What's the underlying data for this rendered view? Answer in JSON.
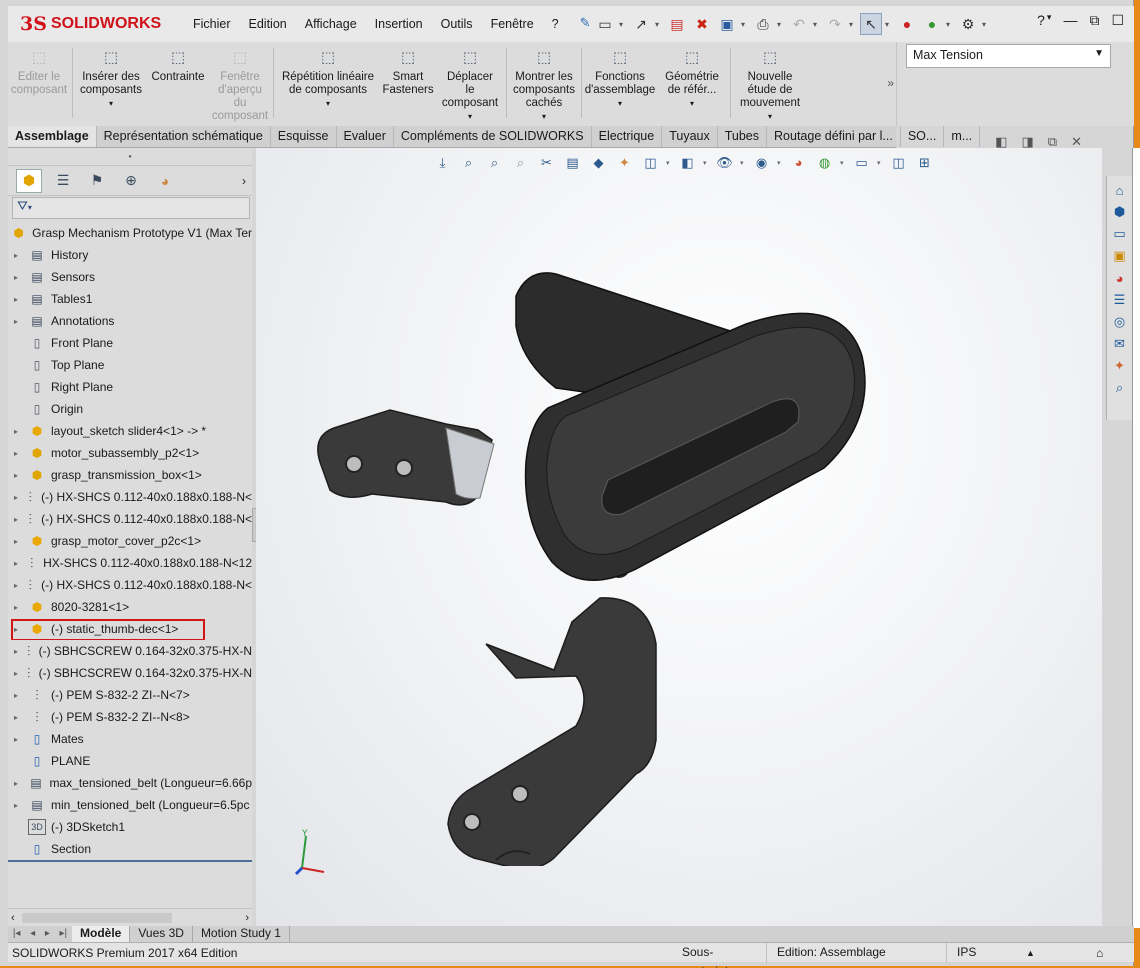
{
  "app": {
    "logo_ds": "3S",
    "logo_text": "SOLIDWORKS"
  },
  "menu": [
    "Fichier",
    "Edition",
    "Affichage",
    "Insertion",
    "Outils",
    "Fenêtre",
    "?"
  ],
  "config_combo": {
    "value": "Max Tension"
  },
  "commands": [
    {
      "label": "Editer le composant",
      "icon": "edit-component-icon",
      "disabled": true
    },
    {
      "label": "Insérer des composants",
      "icon": "insert-components-icon",
      "disabled": false
    },
    {
      "label": "Contrainte",
      "icon": "mate-icon",
      "disabled": false
    },
    {
      "label": "Fenêtre d'aperçu du composant",
      "icon": "preview-window-icon",
      "disabled": true
    },
    {
      "label": "Répétition linéaire de composants",
      "icon": "linear-pattern-icon",
      "disabled": false
    },
    {
      "label": "Smart Fasteners",
      "icon": "smart-fasteners-icon",
      "disabled": false
    },
    {
      "label": "Déplacer le composant",
      "icon": "move-component-icon",
      "disabled": false
    },
    {
      "label": "Montrer les composants cachés",
      "icon": "show-hidden-icon",
      "disabled": false
    },
    {
      "label": "Fonctions d'assemblage",
      "icon": "assembly-features-icon",
      "disabled": false
    },
    {
      "label": "Géométrie de référ...",
      "icon": "reference-geometry-icon",
      "disabled": false
    },
    {
      "label": "Nouvelle étude de mouvement",
      "icon": "motion-study-icon",
      "disabled": false
    }
  ],
  "tabs": [
    "Assemblage",
    "Représentation schématique",
    "Esquisse",
    "Evaluer",
    "Compléments de SOLIDWORKS",
    "Electrique",
    "Tuyaux",
    "Tubes",
    "Routage défini par l...",
    "SO...",
    "m..."
  ],
  "tree": {
    "root": "Grasp Mechanism Prototype V1  (Max Ter",
    "items": [
      {
        "label": "History",
        "icon": "history-icon",
        "kind": "folder",
        "expand": true
      },
      {
        "label": "Sensors",
        "icon": "sensors-icon",
        "kind": "folder",
        "expand": true
      },
      {
        "label": "Tables1",
        "icon": "tables-icon",
        "kind": "folder",
        "expand": true
      },
      {
        "label": "Annotations",
        "icon": "annotations-icon",
        "kind": "folder",
        "expand": true
      },
      {
        "label": "Front Plane",
        "icon": "plane-icon",
        "kind": "plane",
        "expand": false
      },
      {
        "label": "Top Plane",
        "icon": "plane-icon",
        "kind": "plane",
        "expand": false
      },
      {
        "label": "Right Plane",
        "icon": "plane-icon",
        "kind": "plane",
        "expand": false
      },
      {
        "label": "Origin",
        "icon": "origin-icon",
        "kind": "plane",
        "expand": false
      },
      {
        "label": "layout_sketch slider4<1> -> *",
        "icon": "part-icon",
        "kind": "part",
        "expand": true
      },
      {
        "label": "motor_subassembly_p2<1>",
        "icon": "assembly-icon",
        "kind": "asm",
        "expand": true
      },
      {
        "label": "grasp_transmission_box<1>",
        "icon": "assembly-icon",
        "kind": "asm",
        "expand": true
      },
      {
        "label": "(-) HX-SHCS 0.112-40x0.188x0.188-N<",
        "icon": "screw-icon",
        "kind": "screw",
        "expand": true
      },
      {
        "label": "(-) HX-SHCS 0.112-40x0.188x0.188-N<",
        "icon": "screw-icon",
        "kind": "screw",
        "expand": true
      },
      {
        "label": "grasp_motor_cover_p2c<1>",
        "icon": "part-icon",
        "kind": "part",
        "expand": true
      },
      {
        "label": "HX-SHCS 0.112-40x0.188x0.188-N<12",
        "icon": "screw-icon",
        "kind": "screw",
        "expand": true
      },
      {
        "label": "(-) HX-SHCS 0.112-40x0.188x0.188-N<",
        "icon": "screw-icon",
        "kind": "screw",
        "expand": true
      },
      {
        "label": "8020-3281<1>",
        "icon": "part-icon",
        "kind": "part",
        "expand": true
      },
      {
        "label": "(-) static_thumb-dec<1>",
        "icon": "part-icon",
        "kind": "part",
        "expand": true,
        "highlight": true
      },
      {
        "label": "(-) SBHCSCREW 0.164-32x0.375-HX-N",
        "icon": "screw-icon",
        "kind": "screw",
        "expand": true
      },
      {
        "label": "(-) SBHCSCREW 0.164-32x0.375-HX-N",
        "icon": "screw-icon",
        "kind": "screw",
        "expand": true
      },
      {
        "label": "(-) PEM S-832-2 ZI--N<7>",
        "icon": "screw-icon",
        "kind": "screw",
        "expand": true
      },
      {
        "label": "(-) PEM S-832-2 ZI--N<8>",
        "icon": "screw-icon",
        "kind": "screw",
        "expand": true
      },
      {
        "label": "Mates",
        "icon": "mates-icon",
        "kind": "blue",
        "expand": true
      },
      {
        "label": "PLANE",
        "icon": "plane-folder-icon",
        "kind": "blue",
        "expand": false
      },
      {
        "label": "max_tensioned_belt (Longueur=6.66p",
        "icon": "belt-icon",
        "kind": "folder",
        "expand": true
      },
      {
        "label": "min_tensioned_belt (Longueur=6.5pc",
        "icon": "belt-icon",
        "kind": "folder",
        "expand": true
      },
      {
        "label": "(-) 3DSketch1",
        "icon": "3dsketch-icon",
        "kind": "folder",
        "expand": false,
        "badge": "3D"
      },
      {
        "label": "Section",
        "icon": "section-icon",
        "kind": "blue",
        "expand": false
      }
    ]
  },
  "triad": {
    "y": "Y"
  },
  "bottom_tabs": [
    "Modèle",
    "Vues 3D",
    "Motion Study 1"
  ],
  "status": {
    "edition": "SOLIDWORKS Premium 2017 x64 Edition",
    "state": "Sous-contraint",
    "mode": "Edition: Assemblage",
    "units": "IPS"
  }
}
